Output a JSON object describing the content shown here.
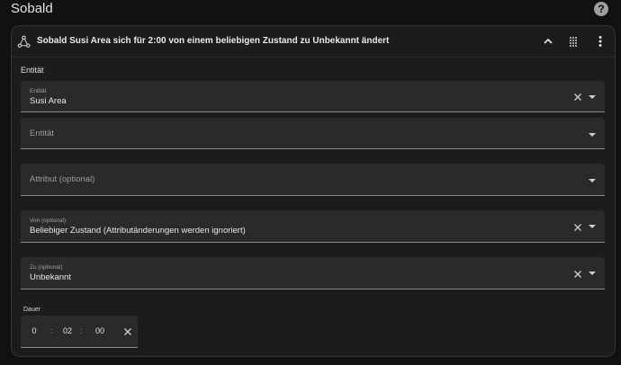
{
  "page": {
    "title": "Sobald"
  },
  "card": {
    "title": "Sobald Susi Area sich für 2:00 von einem beliebigen Zustand zu Unbekannt ändert",
    "section_label": "Entität"
  },
  "fields": {
    "entity": {
      "label": "Entität",
      "value": "Susi Area"
    },
    "entity_empty": {
      "placeholder": "Entität"
    },
    "attribute": {
      "placeholder": "Attribut (optional)"
    },
    "from": {
      "label": "Von (optional)",
      "value": "Beliebiger Zustand (Attributänderungen werden ignoriert)"
    },
    "to": {
      "label": "Zu (optional)",
      "value": "Unbekannt"
    }
  },
  "duration": {
    "label": "Dauer",
    "hours": "0",
    "minutes": "02",
    "seconds": "00",
    "separator": ":"
  },
  "colors": {
    "background": "#111111",
    "card": "#1c1c1c",
    "field": "#2a2a2a"
  },
  "icons": [
    "help-icon",
    "trigger-icon",
    "chevron-up-icon",
    "drag-handle-icon",
    "more-vertical-icon",
    "close-icon",
    "dropdown-arrow-icon"
  ]
}
